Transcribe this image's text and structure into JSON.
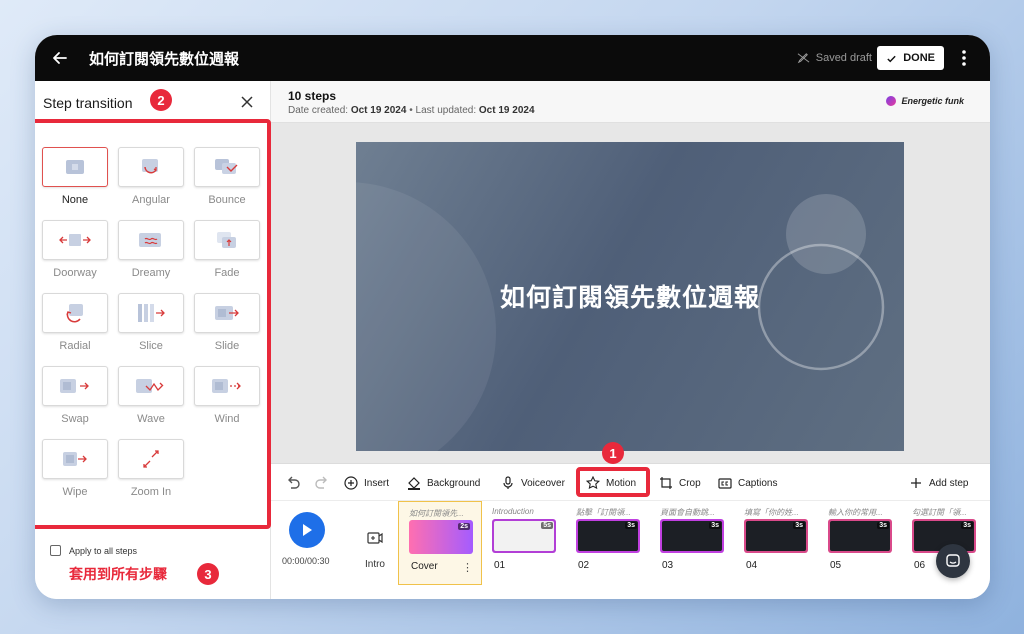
{
  "topbar": {
    "title": "如何訂閱領先數位週報",
    "saved_label": "Saved draft",
    "done_label": "DONE"
  },
  "panel": {
    "title": "Step transition",
    "badge_panel": "2",
    "transitions": [
      {
        "label": "None",
        "selected": true
      },
      {
        "label": "Angular"
      },
      {
        "label": "Bounce"
      },
      {
        "label": "Doorway"
      },
      {
        "label": "Dreamy"
      },
      {
        "label": "Fade"
      },
      {
        "label": "Radial"
      },
      {
        "label": "Slice"
      },
      {
        "label": "Slide"
      },
      {
        "label": "Swap"
      },
      {
        "label": "Wave"
      },
      {
        "label": "Wind"
      },
      {
        "label": "Wipe"
      },
      {
        "label": "Zoom In"
      }
    ],
    "apply_all_label": "Apply to all steps",
    "apply_all_checked": false,
    "badge_apply": "3",
    "apply_note": "套用到所有步驟"
  },
  "header": {
    "steps_count": "10 steps",
    "date_created_label": "Date created:",
    "date_created": "Oct 19 2024",
    "separator": "•",
    "last_updated_label": "Last updated:",
    "last_updated": "Oct 19 2024",
    "music": "Energetic funk"
  },
  "slide": {
    "title": "如何訂閱領先數位週報"
  },
  "toolbar": {
    "insert": "Insert",
    "background": "Background",
    "voiceover": "Voiceover",
    "motion": "Motion",
    "crop": "Crop",
    "captions": "Captions",
    "add_step": "Add step",
    "badge_motion": "1"
  },
  "timeline": {
    "time": "00:00/00:30",
    "intro_label": "Intro",
    "cards": [
      {
        "caption": "如何訂閱領先...",
        "label": "Cover",
        "duration": "2s",
        "active": true
      },
      {
        "caption": "Introduction",
        "label": "01",
        "duration": "5s"
      },
      {
        "caption": "點擊「訂閱領...",
        "label": "02",
        "duration": "3s"
      },
      {
        "caption": "頁面會自動跳...",
        "label": "03",
        "duration": "3s"
      },
      {
        "caption": "填寫「你的姓...",
        "label": "04",
        "duration": "3s"
      },
      {
        "caption": "輸入你的常用...",
        "label": "05",
        "duration": "3s"
      },
      {
        "caption": "勾選訂閱「領...",
        "label": "06",
        "duration": "3s"
      }
    ]
  },
  "colors": {
    "accent_red": "#e8293b",
    "primary_blue": "#1e6fe8",
    "active_card_border": "#f0c24a"
  }
}
